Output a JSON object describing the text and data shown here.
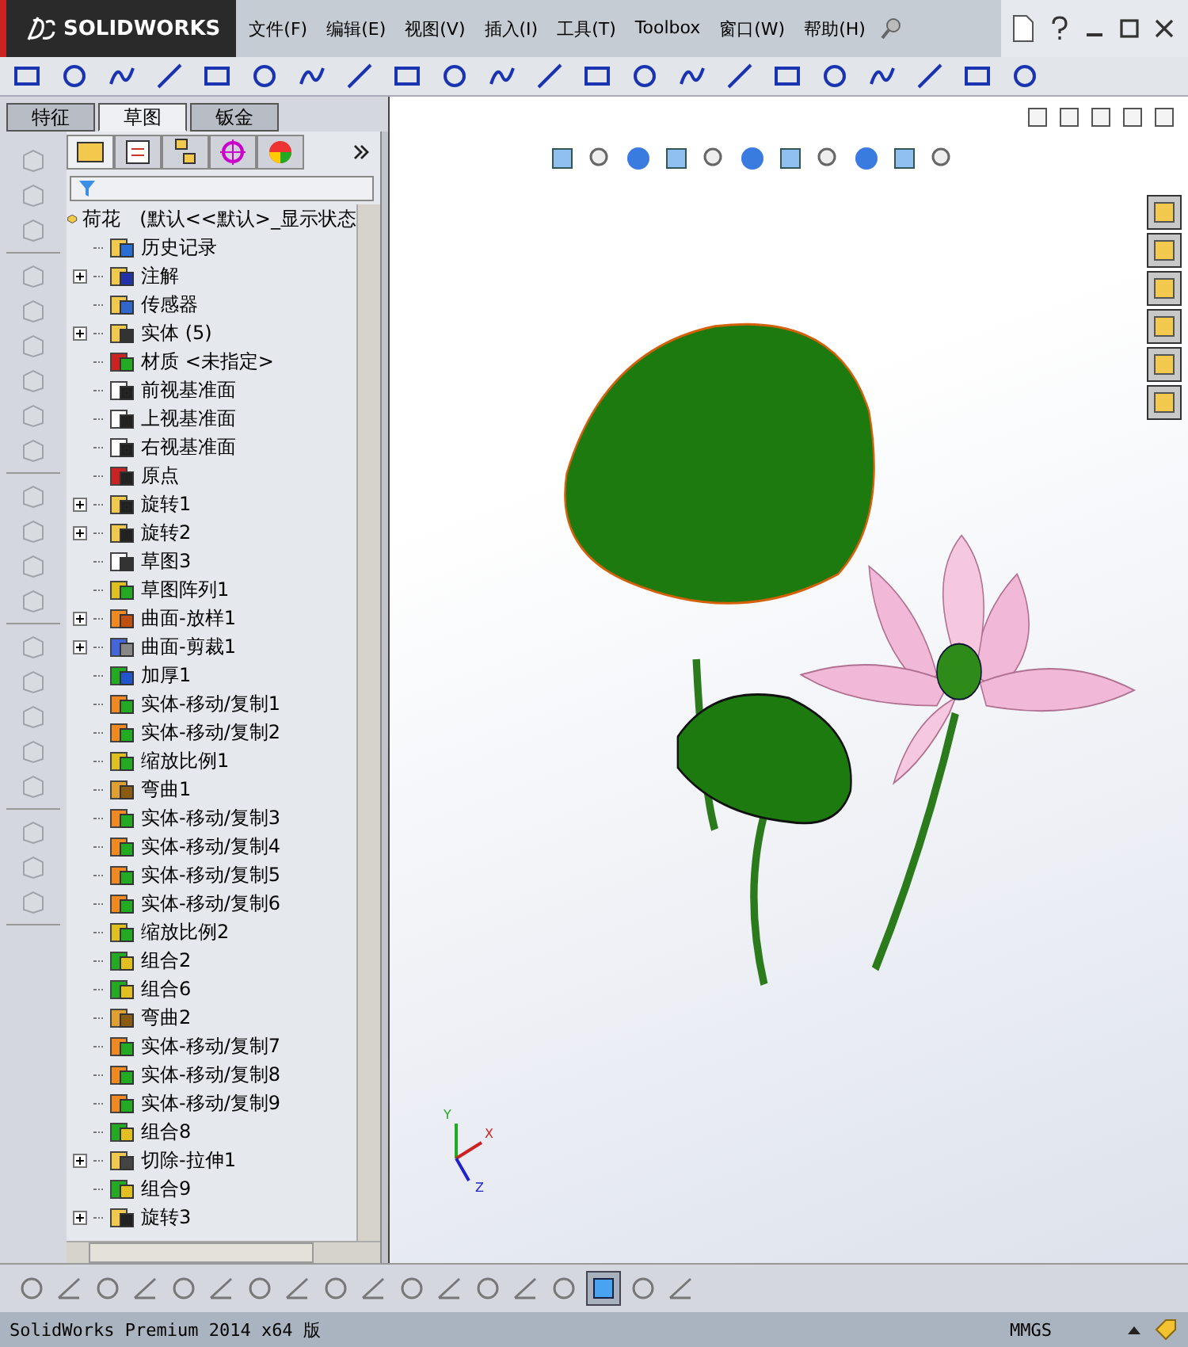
{
  "title_bar": {
    "logo_text": "SOLIDWORKS",
    "menu": [
      "文件(F)",
      "编辑(E)",
      "视图(V)",
      "插入(I)",
      "工具(T)",
      "Toolbox",
      "窗口(W)",
      "帮助(H)"
    ]
  },
  "panel_tabs": [
    {
      "label": "特征",
      "selected": false
    },
    {
      "label": "草图",
      "selected": true
    },
    {
      "label": "钣金",
      "selected": false
    }
  ],
  "feature_tree": {
    "root": "荷花　(默认<<默认>_显示状态",
    "items": [
      {
        "label": "历史记录",
        "kind": "history",
        "has_children": false
      },
      {
        "label": "注解",
        "kind": "annotation",
        "has_children": true
      },
      {
        "label": "传感器",
        "kind": "sensor",
        "has_children": false
      },
      {
        "label": "实体 (5)",
        "kind": "solids",
        "has_children": true
      },
      {
        "label": "材质 <未指定>",
        "kind": "material",
        "has_children": false
      },
      {
        "label": "前视基准面",
        "kind": "plane",
        "has_children": false
      },
      {
        "label": "上视基准面",
        "kind": "plane",
        "has_children": false
      },
      {
        "label": "右视基准面",
        "kind": "plane",
        "has_children": false
      },
      {
        "label": "原点",
        "kind": "origin",
        "has_children": false
      },
      {
        "label": "旋转1",
        "kind": "revolve",
        "has_children": true
      },
      {
        "label": "旋转2",
        "kind": "revolve",
        "has_children": true
      },
      {
        "label": "草图3",
        "kind": "sketch",
        "has_children": false
      },
      {
        "label": "草图阵列1",
        "kind": "pattern",
        "has_children": false
      },
      {
        "label": "曲面-放样1",
        "kind": "loft",
        "has_children": true
      },
      {
        "label": "曲面-剪裁1",
        "kind": "trim",
        "has_children": true
      },
      {
        "label": "加厚1",
        "kind": "thicken",
        "has_children": false
      },
      {
        "label": "实体-移动/复制1",
        "kind": "move",
        "has_children": false
      },
      {
        "label": "实体-移动/复制2",
        "kind": "move",
        "has_children": false
      },
      {
        "label": "缩放比例1",
        "kind": "scale",
        "has_children": false
      },
      {
        "label": "弯曲1",
        "kind": "flex",
        "has_children": false
      },
      {
        "label": "实体-移动/复制3",
        "kind": "move",
        "has_children": false
      },
      {
        "label": "实体-移动/复制4",
        "kind": "move",
        "has_children": false
      },
      {
        "label": "实体-移动/复制5",
        "kind": "move",
        "has_children": false
      },
      {
        "label": "实体-移动/复制6",
        "kind": "move",
        "has_children": false
      },
      {
        "label": "缩放比例2",
        "kind": "scale",
        "has_children": false
      },
      {
        "label": "组合2",
        "kind": "combine",
        "has_children": false
      },
      {
        "label": "组合6",
        "kind": "combine",
        "has_children": false
      },
      {
        "label": "弯曲2",
        "kind": "flex",
        "has_children": false
      },
      {
        "label": "实体-移动/复制7",
        "kind": "move",
        "has_children": false
      },
      {
        "label": "实体-移动/复制8",
        "kind": "move",
        "has_children": false
      },
      {
        "label": "实体-移动/复制9",
        "kind": "move",
        "has_children": false
      },
      {
        "label": "组合8",
        "kind": "combine",
        "has_children": false
      },
      {
        "label": "切除-拉伸1",
        "kind": "cut",
        "has_children": true
      },
      {
        "label": "组合9",
        "kind": "combine",
        "has_children": false
      },
      {
        "label": "旋转3",
        "kind": "revolve",
        "has_children": true
      }
    ]
  },
  "triad": {
    "labels": [
      "Y",
      "X",
      "Z"
    ]
  },
  "status_bar": {
    "text": "SolidWorks Premium 2014 x64 版",
    "units": "MMGS"
  }
}
